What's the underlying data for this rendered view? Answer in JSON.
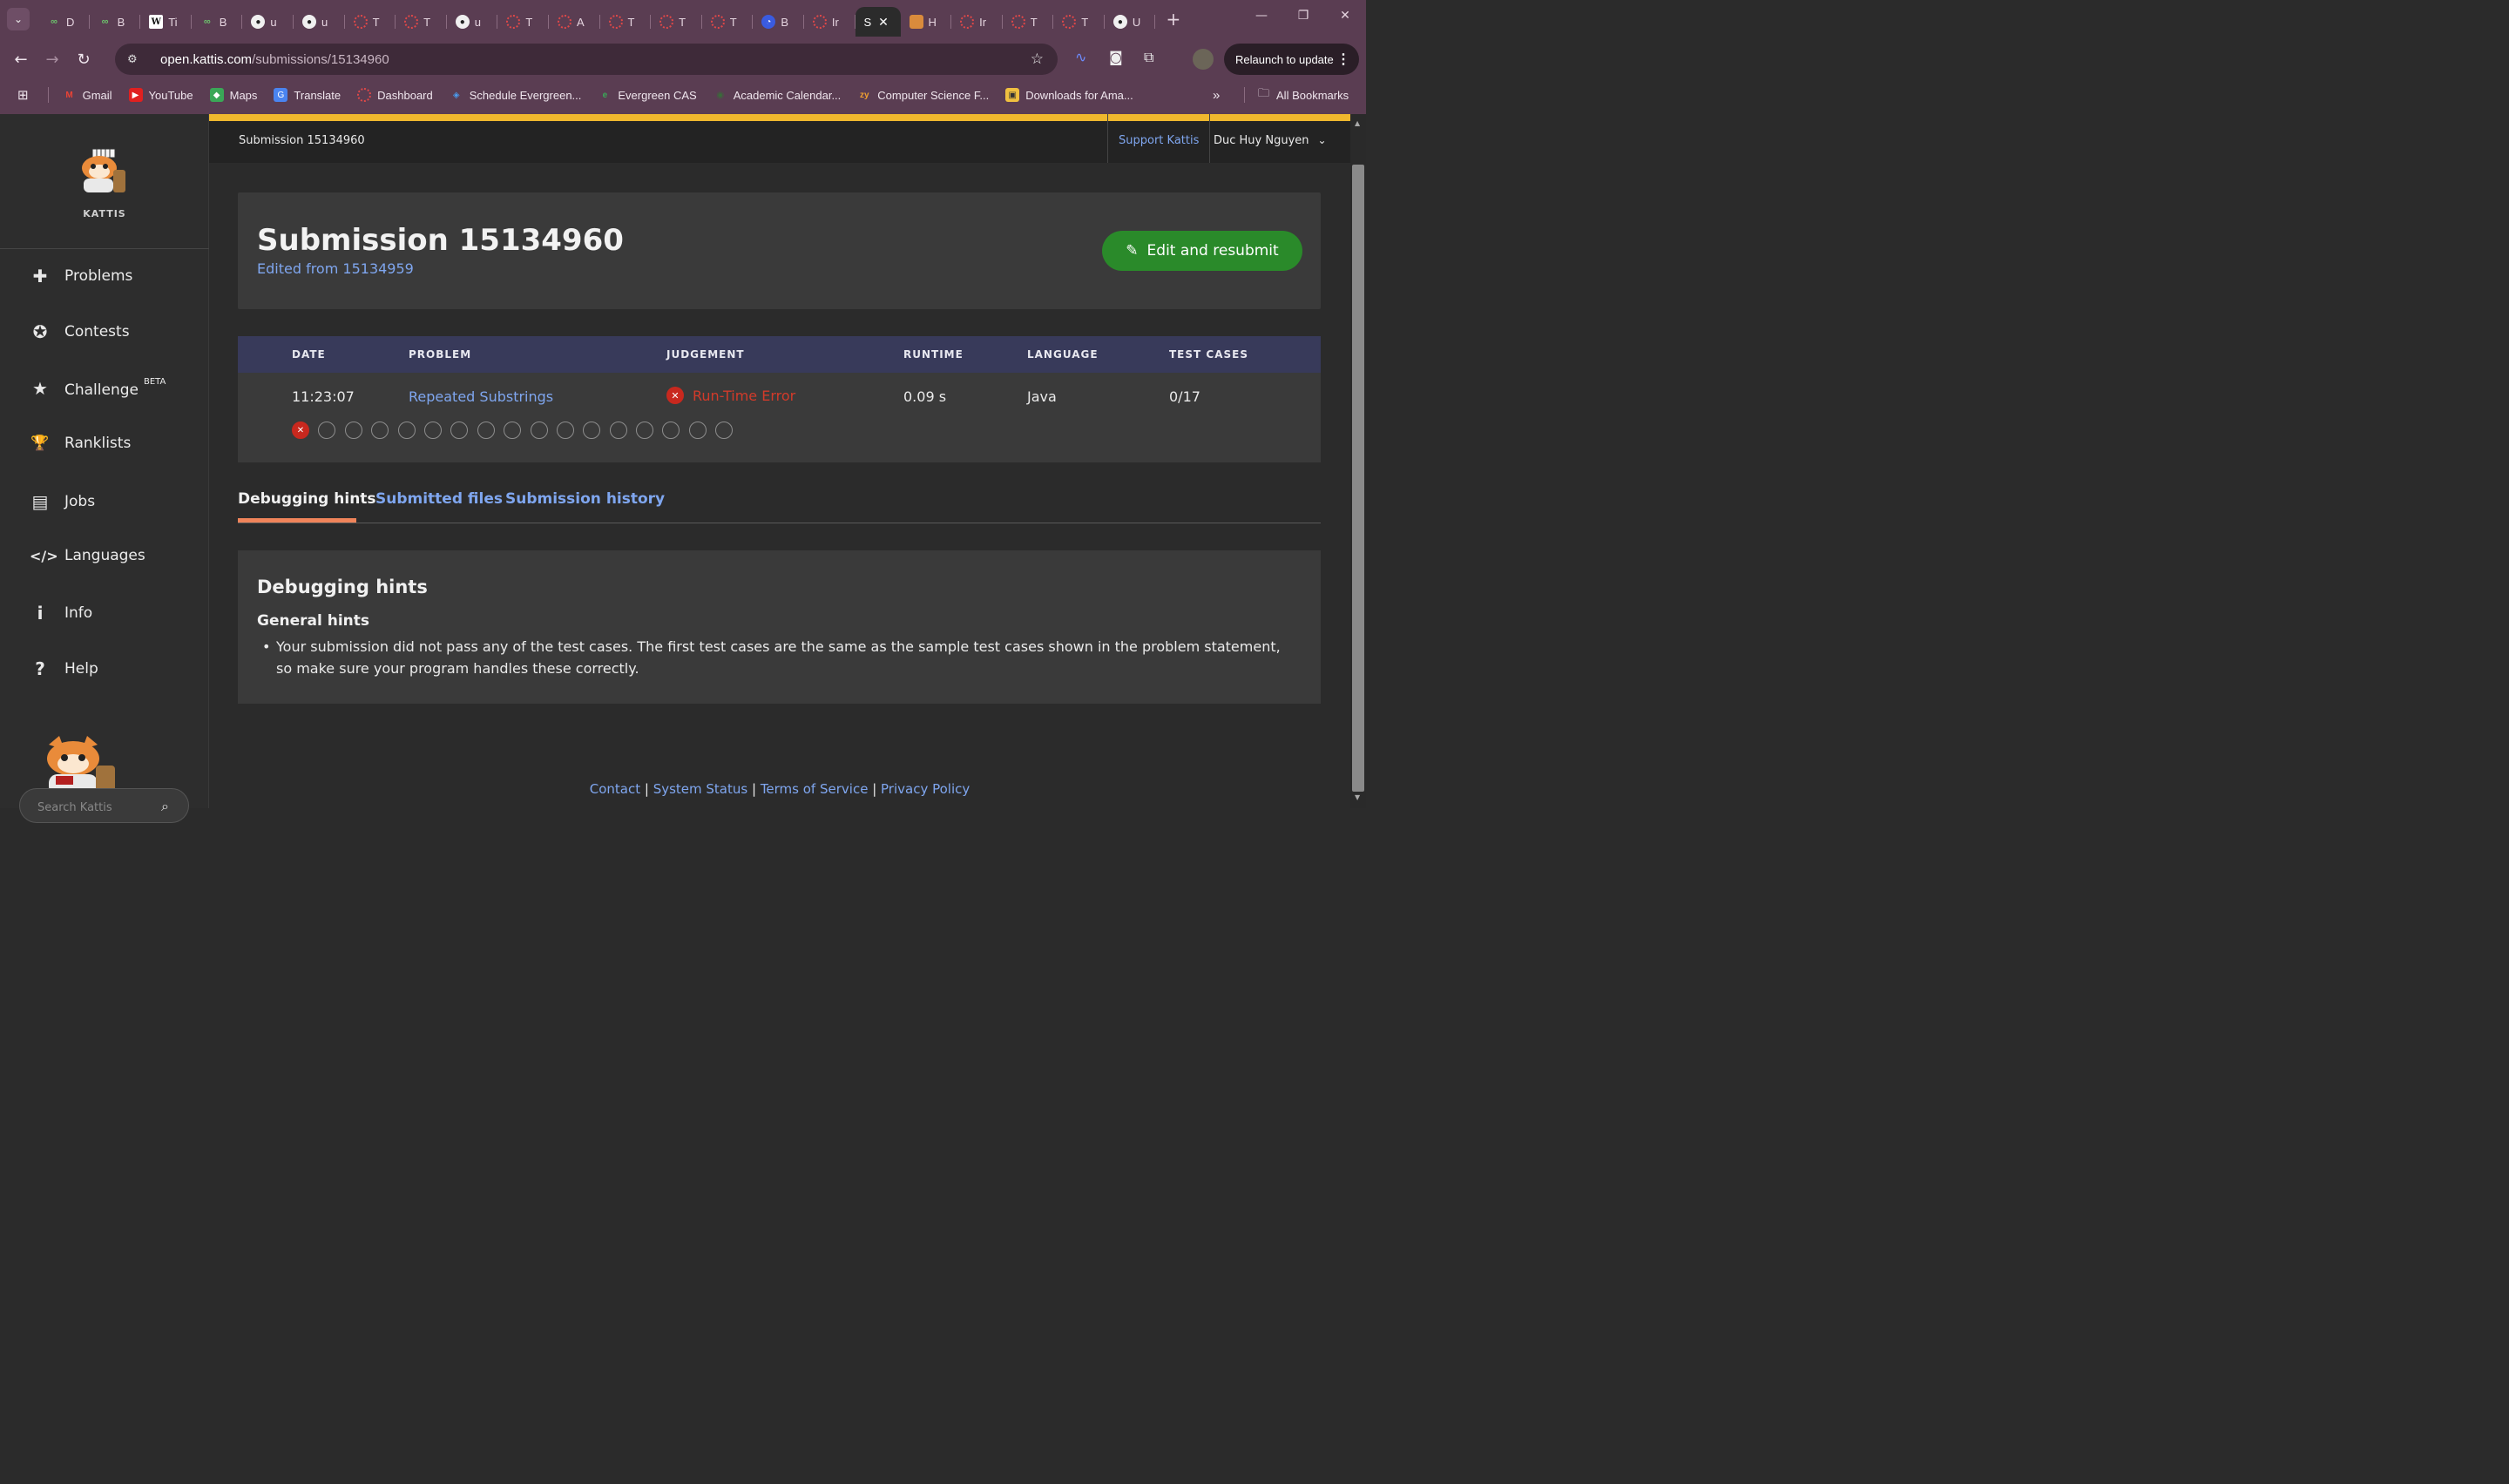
{
  "browser": {
    "tabs": [
      {
        "letter": "D",
        "icon": "green"
      },
      {
        "letter": "B",
        "icon": "green"
      },
      {
        "letter": "Ti",
        "icon": "wiki"
      },
      {
        "letter": "B",
        "icon": "green"
      },
      {
        "letter": "u",
        "icon": "gh"
      },
      {
        "letter": "u",
        "icon": "gh"
      },
      {
        "letter": "T",
        "icon": "red"
      },
      {
        "letter": "T",
        "icon": "red"
      },
      {
        "letter": "u",
        "icon": "gh"
      },
      {
        "letter": "T",
        "icon": "red"
      },
      {
        "letter": "A",
        "icon": "red"
      },
      {
        "letter": "T",
        "icon": "red"
      },
      {
        "letter": "T",
        "icon": "red"
      },
      {
        "letter": "T",
        "icon": "red"
      },
      {
        "letter": "B",
        "icon": "blue"
      },
      {
        "letter": "Ir",
        "icon": "red"
      },
      {
        "letter": "S",
        "icon": "active"
      },
      {
        "letter": "H",
        "icon": "kat"
      },
      {
        "letter": "Ir",
        "icon": "red"
      },
      {
        "letter": "T",
        "icon": "red"
      },
      {
        "letter": "T",
        "icon": "red"
      },
      {
        "letter": "U",
        "icon": "gh"
      }
    ],
    "url_host": "open.kattis.com",
    "url_path": "/submissions/15134960",
    "relaunch_label": "Relaunch to update",
    "bookmarks": [
      "Gmail",
      "YouTube",
      "Maps",
      "Translate",
      "Dashboard",
      "Schedule Evergreen...",
      "Evergreen CAS",
      "Academic Calendar...",
      "Computer Science F...",
      "Downloads for Ama..."
    ],
    "all_bookmarks": "All Bookmarks"
  },
  "sidebar": {
    "logo_text": "KATTIS",
    "items": [
      {
        "label": "Problems",
        "icon": "puzzle-icon",
        "glyph": "✚"
      },
      {
        "label": "Contests",
        "icon": "contest-icon",
        "glyph": "✪"
      },
      {
        "label": "Challenge",
        "icon": "star-icon",
        "glyph": "★",
        "badge": "BETA"
      },
      {
        "label": "Ranklists",
        "icon": "trophy-icon",
        "glyph": "🏆"
      },
      {
        "label": "Jobs",
        "icon": "briefcase-icon",
        "glyph": "▤"
      },
      {
        "label": "Languages",
        "icon": "code-icon",
        "glyph": "</>"
      },
      {
        "label": "Info",
        "icon": "info-icon",
        "glyph": "i"
      },
      {
        "label": "Help",
        "icon": "help-icon",
        "glyph": "?"
      }
    ],
    "search_placeholder": "Search Kattis"
  },
  "topbar": {
    "title": "Submission 15134960",
    "support": "Support Kattis",
    "user": "Duc Huy Nguyen"
  },
  "submission": {
    "title": "Submission 15134960",
    "edited_prefix": "Edited from",
    "edited_id": "15134959",
    "resubmit_label": "Edit and resubmit"
  },
  "table": {
    "headers": [
      "DATE",
      "PROBLEM",
      "JUDGEMENT",
      "RUNTIME",
      "LANGUAGE",
      "TEST CASES"
    ],
    "row": {
      "date": "11:23:07",
      "problem": "Repeated Substrings",
      "judgement": "Run-Time Error",
      "runtime": "0.09 s",
      "language": "Java",
      "test_cases": "0/17"
    },
    "test_case_status": [
      "fail",
      "pending",
      "pending",
      "pending",
      "pending",
      "pending",
      "pending",
      "pending",
      "pending",
      "pending",
      "pending",
      "pending",
      "pending",
      "pending",
      "pending",
      "pending",
      "pending"
    ]
  },
  "page_tabs": [
    "Debugging hints",
    "Submitted files",
    "Submission history"
  ],
  "hints": {
    "heading": "Debugging hints",
    "subheading": "General hints",
    "bullet": "Your submission did not pass any of the test cases. The first test cases are the same as the sample test cases shown in the problem statement, so make sure your program handles these correctly."
  },
  "footer": {
    "links": [
      "Contact",
      "System Status",
      "Terms of Service",
      "Privacy Policy"
    ]
  },
  "colors": {
    "accent_yellow": "#f0b82e",
    "link_blue": "#7fa6ef",
    "error_red": "#d23a2a",
    "resubmit_green": "#2a8a2a",
    "tab_underline": "#f0845a"
  }
}
